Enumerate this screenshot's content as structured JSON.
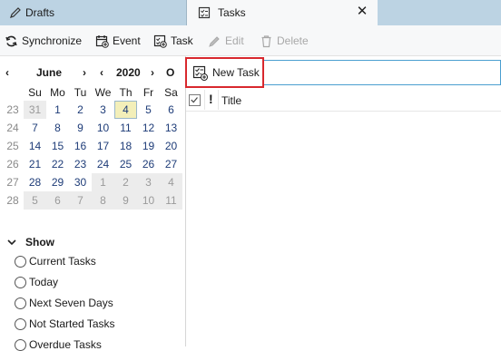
{
  "tabs": [
    {
      "label": "Drafts",
      "icon": "pencil-icon"
    },
    {
      "label": "Tasks",
      "icon": "tasks-icon",
      "close": "✕"
    }
  ],
  "toolbar": {
    "synchronize": "Synchronize",
    "event": "Event",
    "task": "Task",
    "edit": "Edit",
    "delete": "Delete"
  },
  "minimonth": {
    "month": "June",
    "year": "2020",
    "prev_month": "‹",
    "next_month": "›",
    "prev_year": "‹",
    "next_year": "›",
    "today_button": "O",
    "weekdays": [
      "Su",
      "Mo",
      "Tu",
      "We",
      "Th",
      "Fr",
      "Sa"
    ],
    "weeks": [
      {
        "num": "23",
        "days": [
          "31",
          "1",
          "2",
          "3",
          "4",
          "5",
          "6"
        ]
      },
      {
        "num": "24",
        "days": [
          "7",
          "8",
          "9",
          "10",
          "11",
          "12",
          "13"
        ]
      },
      {
        "num": "25",
        "days": [
          "14",
          "15",
          "16",
          "17",
          "18",
          "19",
          "20"
        ]
      },
      {
        "num": "26",
        "days": [
          "21",
          "22",
          "23",
          "24",
          "25",
          "26",
          "27"
        ]
      },
      {
        "num": "27",
        "days": [
          "28",
          "29",
          "30",
          "1",
          "2",
          "3",
          "4"
        ]
      },
      {
        "num": "28",
        "days": [
          "5",
          "6",
          "7",
          "8",
          "9",
          "10",
          "11"
        ]
      }
    ],
    "today": "4"
  },
  "filter": {
    "heading": "Show",
    "options": [
      "Current Tasks",
      "Today",
      "Next Seven Days",
      "Not Started Tasks",
      "Overdue Tasks"
    ]
  },
  "tasks": {
    "new_task": "New Task",
    "header_priority": "!",
    "header_title": "Title"
  },
  "colors": {
    "accent_red": "#d8282e",
    "tab_bg": "#bcd3e3",
    "focus_blue": "#4a9fd0",
    "today_bg": "#f3efb9"
  }
}
